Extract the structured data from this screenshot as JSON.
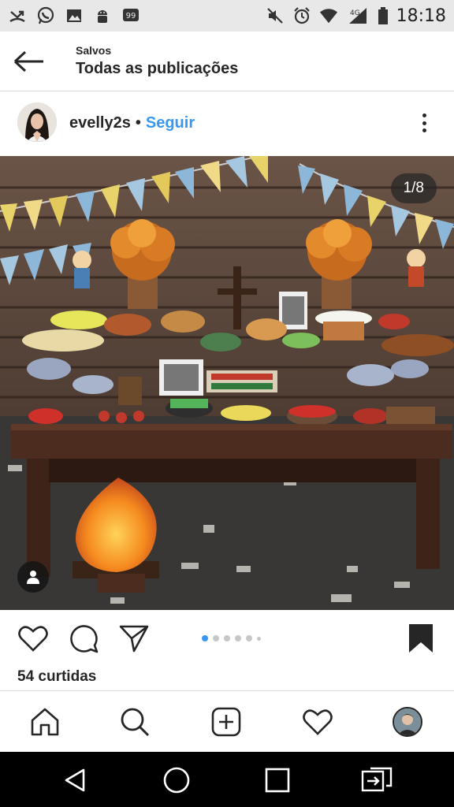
{
  "status_bar": {
    "time": "18:18",
    "network_label": "4G",
    "left_icons": [
      "missed-call-icon",
      "whatsapp-icon",
      "gallery-icon",
      "android-icon",
      "hangouts-icon"
    ],
    "right_icons": [
      "mute-icon",
      "alarm-icon",
      "wifi-icon",
      "signal-icon",
      "battery-icon"
    ]
  },
  "header": {
    "subtitle": "Salvos",
    "title": "Todas as publicações"
  },
  "post": {
    "username": "evelly2s",
    "separator": "•",
    "follow_label": "Seguir",
    "counter": "1/8",
    "likes": "54 curtidas",
    "carousel": {
      "total": 8,
      "current": 1
    }
  },
  "colors": {
    "accent": "#3897f0",
    "text": "#262626",
    "status_bar_bg": "#e8e8e8"
  },
  "bottom_nav": [
    "home-icon",
    "search-icon",
    "new-post-icon",
    "activity-icon",
    "profile-avatar"
  ],
  "android_nav": [
    "back-triangle-icon",
    "home-circle-icon",
    "recents-square-icon",
    "screen-mirror-icon"
  ]
}
